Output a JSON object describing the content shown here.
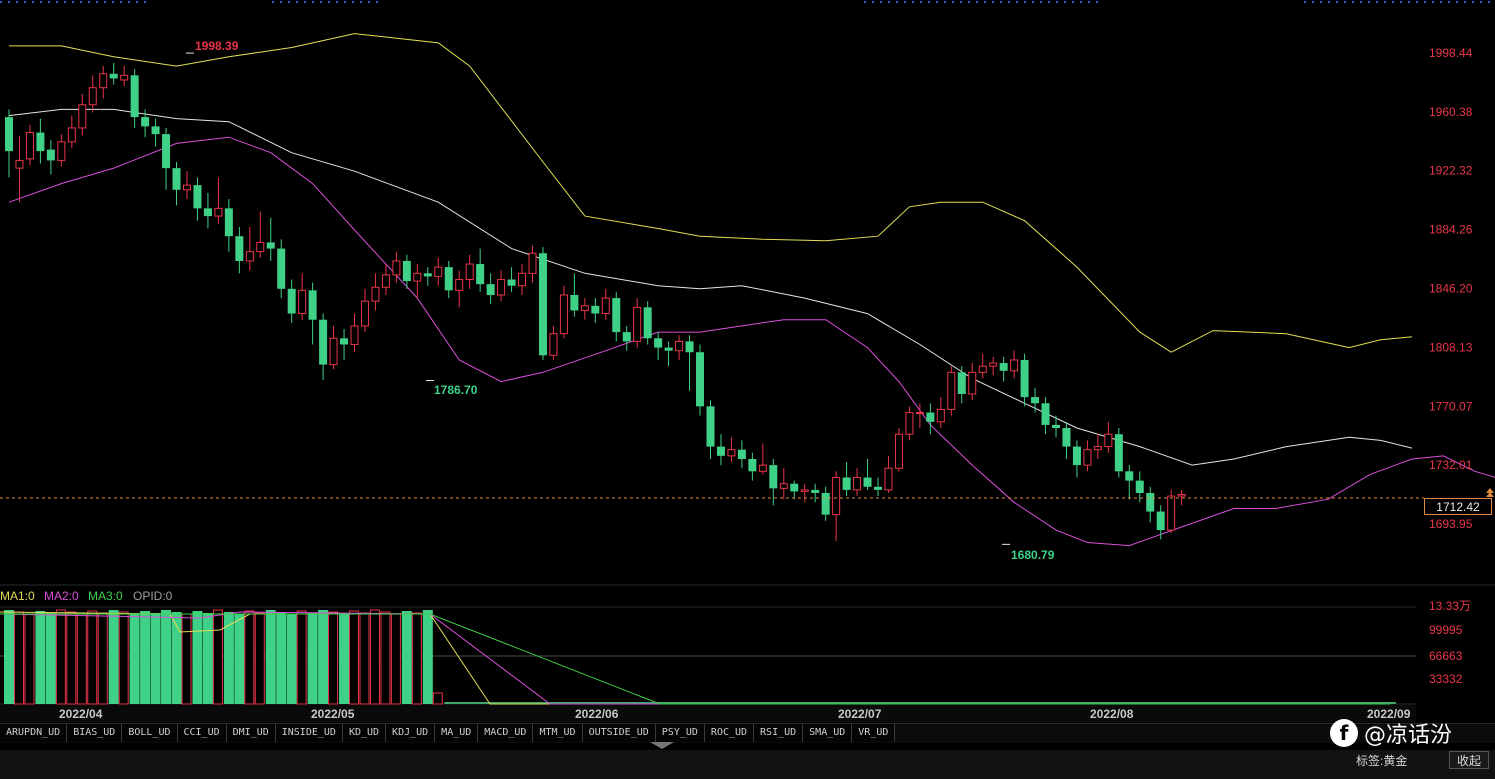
{
  "chart_data": {
    "type": "candlestick",
    "price_axis": {
      "ticks": [
        1998.44,
        1960.38,
        1922.32,
        1884.26,
        1846.2,
        1808.13,
        1770.07,
        1732.01,
        1693.95
      ],
      "range": [
        1660,
        2020
      ]
    },
    "current_price": "1712.42",
    "annotations": {
      "high": "1998.39",
      "low_may": "1786.70",
      "low_jul": "1680.79"
    },
    "date_labels": [
      "2022/04",
      "2022/05",
      "2022/06",
      "2022/07",
      "2022/08",
      "2022/09"
    ],
    "candles": [
      [
        1957,
        1935,
        1962,
        1918
      ],
      [
        1924,
        1929,
        1945,
        1902
      ],
      [
        1930,
        1947,
        1952,
        1926
      ],
      [
        1947,
        1935,
        1956,
        1927
      ],
      [
        1936,
        1929,
        1942,
        1920
      ],
      [
        1929,
        1941,
        1946,
        1925
      ],
      [
        1941,
        1950,
        1958,
        1937
      ],
      [
        1950,
        1965,
        1972,
        1945
      ],
      [
        1965,
        1976,
        1984,
        1960
      ],
      [
        1976,
        1985,
        1990,
        1969
      ],
      [
        1985,
        1982,
        1992,
        1978
      ],
      [
        1981,
        1984,
        1990,
        1977
      ],
      [
        1984,
        1957,
        1988,
        1950
      ],
      [
        1957,
        1951,
        1962,
        1944
      ],
      [
        1951,
        1946,
        1956,
        1938
      ],
      [
        1946,
        1924,
        1950,
        1910
      ],
      [
        1924,
        1910,
        1928,
        1900
      ],
      [
        1910,
        1913,
        1922,
        1904
      ],
      [
        1913,
        1898,
        1918,
        1890
      ],
      [
        1898,
        1893,
        1908,
        1885
      ],
      [
        1893,
        1898,
        1918,
        1888
      ],
      [
        1898,
        1880,
        1904,
        1870
      ],
      [
        1880,
        1864,
        1886,
        1856
      ],
      [
        1864,
        1870,
        1886,
        1858
      ],
      [
        1870,
        1876,
        1896,
        1866
      ],
      [
        1876,
        1872,
        1892,
        1864
      ],
      [
        1872,
        1846,
        1878,
        1840
      ],
      [
        1846,
        1830,
        1852,
        1824
      ],
      [
        1830,
        1845,
        1856,
        1826
      ],
      [
        1845,
        1826,
        1850,
        1810
      ],
      [
        1826,
        1797,
        1830,
        1787
      ],
      [
        1797,
        1814,
        1822,
        1794
      ],
      [
        1814,
        1810,
        1820,
        1800
      ],
      [
        1810,
        1822,
        1830,
        1805
      ],
      [
        1822,
        1838,
        1846,
        1818
      ],
      [
        1838,
        1847,
        1856,
        1832
      ],
      [
        1847,
        1855,
        1862,
        1842
      ],
      [
        1855,
        1864,
        1870,
        1850
      ],
      [
        1864,
        1851,
        1868,
        1846
      ],
      [
        1851,
        1856,
        1862,
        1840
      ],
      [
        1856,
        1854,
        1860,
        1848
      ],
      [
        1854,
        1860,
        1866,
        1848
      ],
      [
        1860,
        1845,
        1864,
        1840
      ],
      [
        1845,
        1852,
        1858,
        1834
      ],
      [
        1852,
        1862,
        1868,
        1846
      ],
      [
        1862,
        1849,
        1872,
        1844
      ],
      [
        1849,
        1842,
        1856,
        1836
      ],
      [
        1842,
        1852,
        1858,
        1838
      ],
      [
        1852,
        1848,
        1860,
        1844
      ],
      [
        1848,
        1856,
        1862,
        1842
      ],
      [
        1856,
        1869,
        1874,
        1850
      ],
      [
        1869,
        1803,
        1873,
        1800
      ],
      [
        1803,
        1817,
        1822,
        1800
      ],
      [
        1817,
        1842,
        1848,
        1814
      ],
      [
        1842,
        1832,
        1856,
        1828
      ],
      [
        1832,
        1835,
        1840,
        1826
      ],
      [
        1835,
        1830,
        1840,
        1824
      ],
      [
        1830,
        1840,
        1846,
        1826
      ],
      [
        1840,
        1818,
        1844,
        1812
      ],
      [
        1818,
        1812,
        1822,
        1806
      ],
      [
        1812,
        1834,
        1840,
        1808
      ],
      [
        1834,
        1814,
        1838,
        1810
      ],
      [
        1814,
        1808,
        1818,
        1800
      ],
      [
        1808,
        1806,
        1812,
        1796
      ],
      [
        1806,
        1812,
        1816,
        1800
      ],
      [
        1812,
        1805,
        1816,
        1780
      ],
      [
        1805,
        1770,
        1810,
        1764
      ],
      [
        1770,
        1744,
        1774,
        1736
      ],
      [
        1744,
        1738,
        1752,
        1732
      ],
      [
        1738,
        1742,
        1750,
        1734
      ],
      [
        1742,
        1736,
        1748,
        1730
      ],
      [
        1736,
        1728,
        1740,
        1722
      ],
      [
        1728,
        1732,
        1746,
        1726
      ],
      [
        1732,
        1717,
        1736,
        1706
      ],
      [
        1717,
        1720,
        1730,
        1710
      ],
      [
        1720,
        1715,
        1722,
        1710
      ],
      [
        1715,
        1716,
        1720,
        1708
      ],
      [
        1716,
        1714,
        1720,
        1708
      ],
      [
        1714,
        1700,
        1718,
        1696
      ],
      [
        1700,
        1724,
        1728,
        1683
      ],
      [
        1724,
        1716,
        1734,
        1712
      ],
      [
        1716,
        1724,
        1730,
        1712
      ],
      [
        1724,
        1718,
        1736,
        1716
      ],
      [
        1718,
        1716,
        1724,
        1712
      ],
      [
        1716,
        1730,
        1738,
        1714
      ],
      [
        1730,
        1752,
        1756,
        1728
      ],
      [
        1752,
        1766,
        1770,
        1748
      ],
      [
        1766,
        1766,
        1772,
        1756
      ],
      [
        1766,
        1760,
        1772,
        1752
      ],
      [
        1760,
        1768,
        1776,
        1756
      ],
      [
        1768,
        1792,
        1796,
        1764
      ],
      [
        1792,
        1778,
        1796,
        1772
      ],
      [
        1778,
        1792,
        1798,
        1774
      ],
      [
        1792,
        1796,
        1804,
        1788
      ],
      [
        1796,
        1798,
        1802,
        1790
      ],
      [
        1798,
        1793,
        1802,
        1786
      ],
      [
        1793,
        1800,
        1806,
        1788
      ],
      [
        1800,
        1776,
        1804,
        1770
      ],
      [
        1776,
        1772,
        1782,
        1766
      ],
      [
        1772,
        1758,
        1776,
        1752
      ],
      [
        1758,
        1756,
        1764,
        1750
      ],
      [
        1756,
        1744,
        1760,
        1736
      ],
      [
        1744,
        1732,
        1748,
        1724
      ],
      [
        1732,
        1742,
        1748,
        1728
      ],
      [
        1742,
        1744,
        1752,
        1736
      ],
      [
        1744,
        1752,
        1760,
        1740
      ],
      [
        1752,
        1728,
        1756,
        1724
      ],
      [
        1728,
        1722,
        1732,
        1710
      ],
      [
        1722,
        1714,
        1728,
        1708
      ],
      [
        1714,
        1702,
        1718,
        1695
      ],
      [
        1702,
        1690,
        1706,
        1684
      ],
      [
        1690,
        1712,
        1716,
        1688
      ],
      [
        1712,
        1713,
        1716,
        1706
      ]
    ],
    "boll_upper": [
      [
        0,
        2003
      ],
      [
        5,
        2003
      ],
      [
        10,
        1996
      ],
      [
        16,
        1990
      ],
      [
        21,
        1996
      ],
      [
        27,
        2002
      ],
      [
        33,
        2011
      ],
      [
        41,
        2005
      ],
      [
        44,
        1990
      ],
      [
        51,
        1928
      ],
      [
        55,
        1893
      ],
      [
        62,
        1885
      ],
      [
        66,
        1880
      ],
      [
        72,
        1878
      ],
      [
        78,
        1877
      ],
      [
        83,
        1880
      ],
      [
        86,
        1899
      ],
      [
        89,
        1902
      ],
      [
        93,
        1902
      ],
      [
        97,
        1890
      ],
      [
        102,
        1860
      ],
      [
        108,
        1818
      ],
      [
        111,
        1805
      ],
      [
        115,
        1819
      ],
      [
        122,
        1817
      ],
      [
        128,
        1808
      ],
      [
        131,
        1813
      ],
      [
        134,
        1815
      ]
    ],
    "boll_mid": [
      [
        0,
        1958
      ],
      [
        5,
        1962
      ],
      [
        10,
        1962
      ],
      [
        16,
        1956
      ],
      [
        21,
        1954
      ],
      [
        27,
        1934
      ],
      [
        33,
        1922
      ],
      [
        41,
        1902
      ],
      [
        48,
        1872
      ],
      [
        55,
        1856
      ],
      [
        62,
        1848
      ],
      [
        66,
        1846
      ],
      [
        70,
        1848
      ],
      [
        76,
        1840
      ],
      [
        82,
        1830
      ],
      [
        87,
        1810
      ],
      [
        92,
        1788
      ],
      [
        97,
        1772
      ],
      [
        102,
        1756
      ],
      [
        108,
        1744
      ],
      [
        113,
        1732
      ],
      [
        117,
        1736
      ],
      [
        122,
        1744
      ],
      [
        128,
        1750
      ],
      [
        131,
        1748
      ],
      [
        134,
        1743
      ]
    ],
    "boll_lower": [
      [
        0,
        1902
      ],
      [
        5,
        1914
      ],
      [
        10,
        1924
      ],
      [
        16,
        1940
      ],
      [
        21,
        1944
      ],
      [
        25,
        1934
      ],
      [
        29,
        1914
      ],
      [
        33,
        1884
      ],
      [
        39,
        1840
      ],
      [
        43,
        1800
      ],
      [
        47,
        1786
      ],
      [
        51,
        1792
      ],
      [
        57,
        1806
      ],
      [
        62,
        1818
      ],
      [
        66,
        1818
      ],
      [
        70,
        1822
      ],
      [
        74,
        1826
      ],
      [
        78,
        1826
      ],
      [
        82,
        1808
      ],
      [
        85,
        1786
      ],
      [
        88,
        1758
      ],
      [
        92,
        1732
      ],
      [
        96,
        1708
      ],
      [
        100,
        1690
      ],
      [
        103,
        1682
      ],
      [
        107,
        1680
      ],
      [
        112,
        1692
      ],
      [
        117,
        1704
      ],
      [
        121,
        1704
      ],
      [
        126,
        1710
      ],
      [
        130,
        1726
      ],
      [
        134,
        1736
      ],
      [
        137,
        1738
      ],
      [
        140,
        1728
      ],
      [
        143,
        1722
      ]
    ],
    "volume_legend": [
      "MA1:0",
      "MA2:0",
      "MA3:0",
      "OPID:0"
    ],
    "volume_axis": {
      "ticks": [
        "13.33万",
        "99995",
        "66663",
        "33332"
      ]
    },
    "volume_last_bar_index": 36
  },
  "colors": {
    "up": "#e8364a",
    "down": "#3fd188",
    "boll_upper": "#e3df56",
    "boll_mid": "#e5e5e5",
    "boll_lower": "#d94fd9",
    "ma1": "#e3df56",
    "ma2": "#d94fd9",
    "ma3": "#3fd14a"
  },
  "indicator_tabs": [
    "ARUPDN_UD",
    "BIAS_UD",
    "BOLL_UD",
    "CCI_UD",
    "DMI_UD",
    "INSIDE_UD",
    "KD_UD",
    "KDJ_UD",
    "MA_UD",
    "MACD_UD",
    "MTM_UD",
    "OUTSIDE_UD",
    "PSY_UD",
    "ROC_UD",
    "RSI_UD",
    "SMA_UD",
    "VR_UD"
  ],
  "footer": {
    "tab_label": "标签:黄金",
    "collapse": "收起"
  },
  "watermark": {
    "text": "@凉话汾",
    "logo": "f"
  }
}
